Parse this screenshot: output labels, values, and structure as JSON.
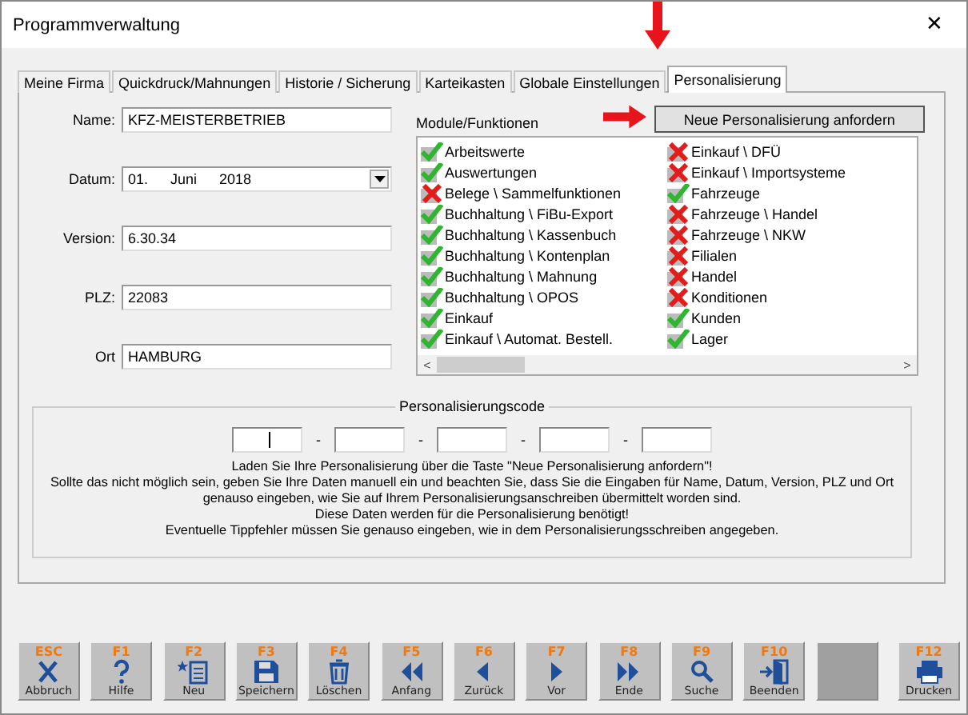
{
  "window": {
    "title": "Programmverwaltung",
    "close": "✕"
  },
  "tabs": [
    {
      "label": "Meine Firma",
      "selected": false
    },
    {
      "label": "Quickdruck/Mahnungen",
      "selected": false
    },
    {
      "label": "Historie / Sicherung",
      "selected": false
    },
    {
      "label": "Karteikasten",
      "selected": false
    },
    {
      "label": "Globale Einstellungen",
      "selected": false
    },
    {
      "label": "Personalisierung",
      "selected": true
    }
  ],
  "form": [
    {
      "label": "Name:",
      "kind": "text",
      "value": "KFZ-MEISTERBETRIEB"
    },
    {
      "label": "Datum:",
      "kind": "date",
      "parts": [
        "01.",
        "Juni",
        "2018"
      ]
    },
    {
      "label": "Version:",
      "kind": "text",
      "value": "6.30.34"
    },
    {
      "label": "PLZ:",
      "kind": "text",
      "value": "22083"
    },
    {
      "label": "Ort",
      "kind": "text",
      "value": "HAMBURG"
    }
  ],
  "modules": {
    "label": "Module/Funktionen",
    "button": "Neue Personalisierung anfordern",
    "columns": [
      [
        {
          "name": "Arbeitswerte",
          "enabled": true
        },
        {
          "name": "Auswertungen",
          "enabled": true
        },
        {
          "name": "Belege \\ Sammelfunktionen",
          "enabled": false
        },
        {
          "name": "Buchhaltung \\ FiBu-Export",
          "enabled": true
        },
        {
          "name": "Buchhaltung \\ Kassenbuch",
          "enabled": true
        },
        {
          "name": "Buchhaltung \\ Kontenplan",
          "enabled": true
        },
        {
          "name": "Buchhaltung \\ Mahnung",
          "enabled": true
        },
        {
          "name": "Buchhaltung \\ OPOS",
          "enabled": true
        },
        {
          "name": "Einkauf",
          "enabled": true
        },
        {
          "name": "Einkauf \\ Automat. Bestell.",
          "enabled": true
        }
      ],
      [
        {
          "name": "Einkauf \\ DFÜ",
          "enabled": false
        },
        {
          "name": "Einkauf \\ Importsysteme",
          "enabled": false
        },
        {
          "name": "Fahrzeuge",
          "enabled": true
        },
        {
          "name": "Fahrzeuge \\ Handel",
          "enabled": false
        },
        {
          "name": "Fahrzeuge \\ NKW",
          "enabled": false
        },
        {
          "name": "Filialen",
          "enabled": false
        },
        {
          "name": "Handel",
          "enabled": false
        },
        {
          "name": "Konditionen",
          "enabled": false
        },
        {
          "name": "Kunden",
          "enabled": true
        },
        {
          "name": "Lager",
          "enabled": true
        }
      ]
    ],
    "scroll_left": "<",
    "scroll_right": ">"
  },
  "code": {
    "title": "Personalisierungscode",
    "fields": [
      {
        "focused": true
      },
      {
        "focused": false
      },
      {
        "focused": false
      },
      {
        "focused": false
      },
      {
        "focused": false
      }
    ],
    "separators": [
      "-",
      "-",
      "-",
      "-"
    ],
    "lines": [
      "Laden Sie Ihre Personalisierung über die Taste \"Neue Personalisierung anfordern\"!",
      "Sollte das nicht möglich sein, geben Sie Ihre Daten manuell ein und beachten Sie, dass Sie die Eingaben für Name, Datum, Version, PLZ und Ort genauso eingeben, wie Sie auf Ihrem Personalisierungsanschreiben übermittelt worden sind.",
      "Diese Daten werden für die Personalisierung benötigt!",
      "Eventuelle Tippfehler müssen Sie genauso eingeben, wie in dem Personalisierungsschreiben angegeben."
    ]
  },
  "toolbar": [
    {
      "kind": "cancel",
      "key": "ESC",
      "label": "Abbruch"
    },
    {
      "kind": "help",
      "key": "F1",
      "label": "Hilfe"
    },
    {
      "kind": "new",
      "key": "F2",
      "label": "Neu"
    },
    {
      "kind": "save",
      "key": "F3",
      "label": "Speichern"
    },
    {
      "kind": "delete",
      "key": "F4",
      "label": "Löschen"
    },
    {
      "kind": "first",
      "key": "F5",
      "label": "Anfang"
    },
    {
      "kind": "prev",
      "key": "F6",
      "label": "Zurück"
    },
    {
      "kind": "next",
      "key": "F7",
      "label": "Vor"
    },
    {
      "kind": "last",
      "key": "F8",
      "label": "Ende"
    },
    {
      "kind": "search",
      "key": "F9",
      "label": "Suche"
    },
    {
      "kind": "exit",
      "key": "F10",
      "label": "Beenden"
    },
    {
      "kind": "blank"
    },
    {
      "kind": "print",
      "key": "F12",
      "label": "Drucken"
    }
  ]
}
